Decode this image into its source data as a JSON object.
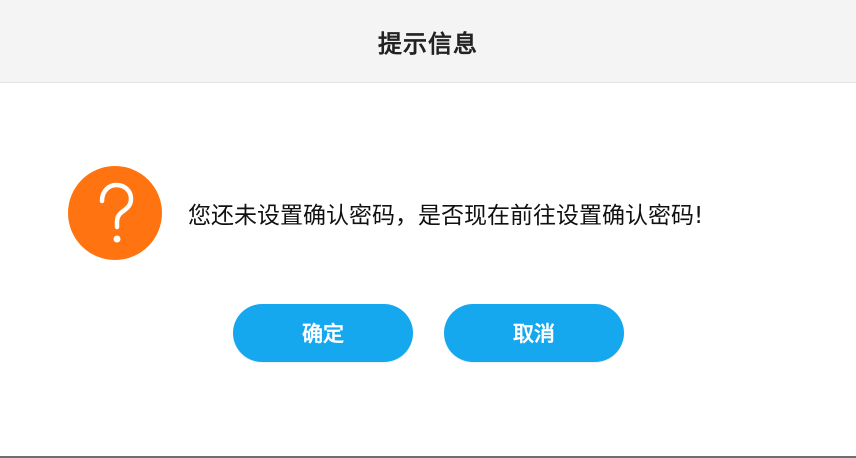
{
  "dialog": {
    "title": "提示信息",
    "icon": "question-icon",
    "icon_color": "#ff7410",
    "message": "您还未设置确认密码，是否现在前往设置确认密码!",
    "buttons": {
      "ok_label": "确定",
      "cancel_label": "取消"
    },
    "button_color": "#15a8ee"
  }
}
